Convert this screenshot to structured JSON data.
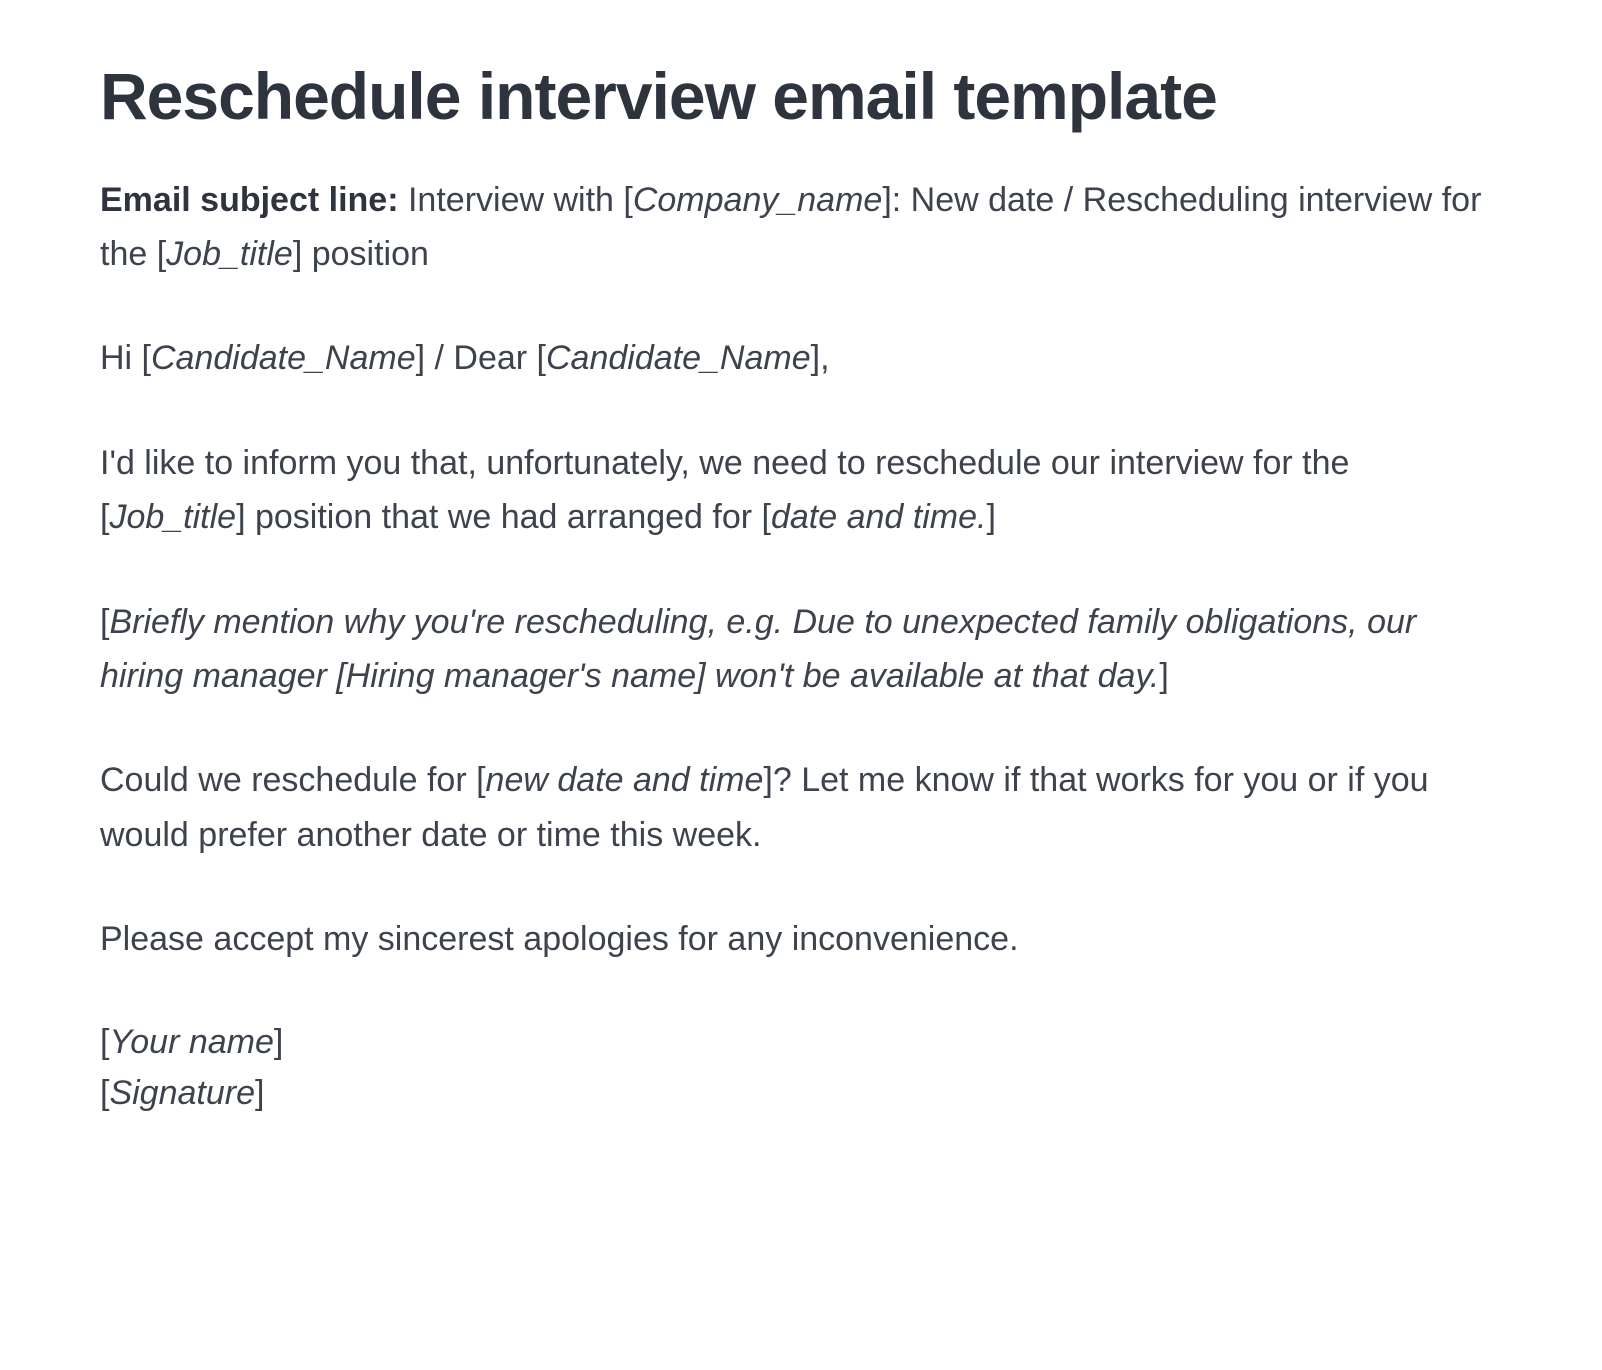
{
  "title": "Reschedule interview email template",
  "subject": {
    "label": "Email subject line:",
    "before_company": " Interview with [",
    "company_ph": "Company_name",
    "after_company": "]: New date / Rescheduling interview for the [",
    "job_ph": "Job_title",
    "after_job": "] position"
  },
  "greeting": {
    "hi": "Hi [",
    "cand1": "Candidate_Name",
    "mid": "] / Dear [",
    "cand2": "Candidate_Name",
    "end": "],"
  },
  "p1": {
    "a": "I'd like to inform you that, unfortunately, we need to reschedule our interview for the [",
    "job": "Job_title",
    "b": "] position that we had arranged for [",
    "dt": "date and time.",
    "c": "]"
  },
  "p2": {
    "a": "[",
    "reason": "Briefly mention why you're rescheduling, e.g. Due to unexpected family obligations, our hiring manager [Hiring manager's name] won't be available at that day.",
    "b": "]"
  },
  "p3": {
    "a": "Could we reschedule for [",
    "ndt": "new date and time",
    "b": "]? Let me know if that works for you or if you would prefer another date or time this week."
  },
  "p4": "Please accept my sincerest apologies for any inconvenience.",
  "sig": {
    "a1": "[",
    "name": "Your name",
    "a2": "]",
    "b1": "[",
    "signature": "Signature",
    "b2": "]"
  }
}
